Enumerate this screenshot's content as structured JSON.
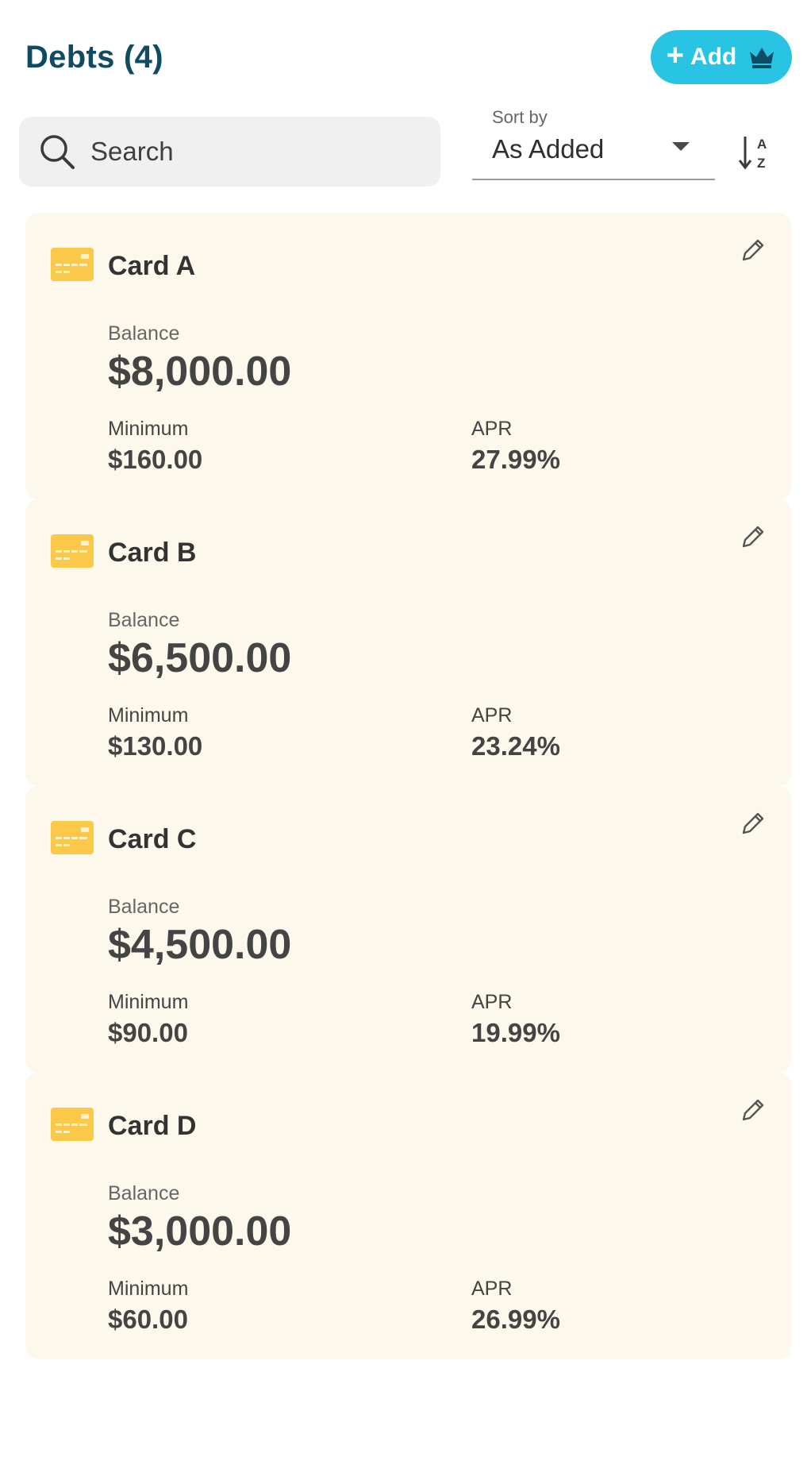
{
  "header": {
    "title": "Debts (4)",
    "add_button": {
      "plus": "+",
      "label": "Add",
      "icon": "crown-icon"
    }
  },
  "search": {
    "placeholder": "Search",
    "value": ""
  },
  "sort": {
    "label": "Sort by",
    "value": "As Added",
    "direction_icon": "sort-az-icon"
  },
  "debts": [
    {
      "name": "Card A",
      "balance_label": "Balance",
      "balance": "$8,000.00",
      "minimum_label": "Minimum",
      "minimum": "$160.00",
      "apr_label": "APR",
      "apr": "27.99%"
    },
    {
      "name": "Card B",
      "balance_label": "Balance",
      "balance": "$6,500.00",
      "minimum_label": "Minimum",
      "minimum": "$130.00",
      "apr_label": "APR",
      "apr": "23.24%"
    },
    {
      "name": "Card C",
      "balance_label": "Balance",
      "balance": "$4,500.00",
      "minimum_label": "Minimum",
      "minimum": "$90.00",
      "apr_label": "APR",
      "apr": "19.99%"
    },
    {
      "name": "Card D",
      "balance_label": "Balance",
      "balance": "$3,000.00",
      "minimum_label": "Minimum",
      "minimum": "$60.00",
      "apr_label": "APR",
      "apr": "26.99%"
    }
  ],
  "colors": {
    "title": "#0f4c64",
    "accent": "#29c4e4",
    "card_background": "#fdf8ec",
    "card_icon": "#fcc84a"
  }
}
